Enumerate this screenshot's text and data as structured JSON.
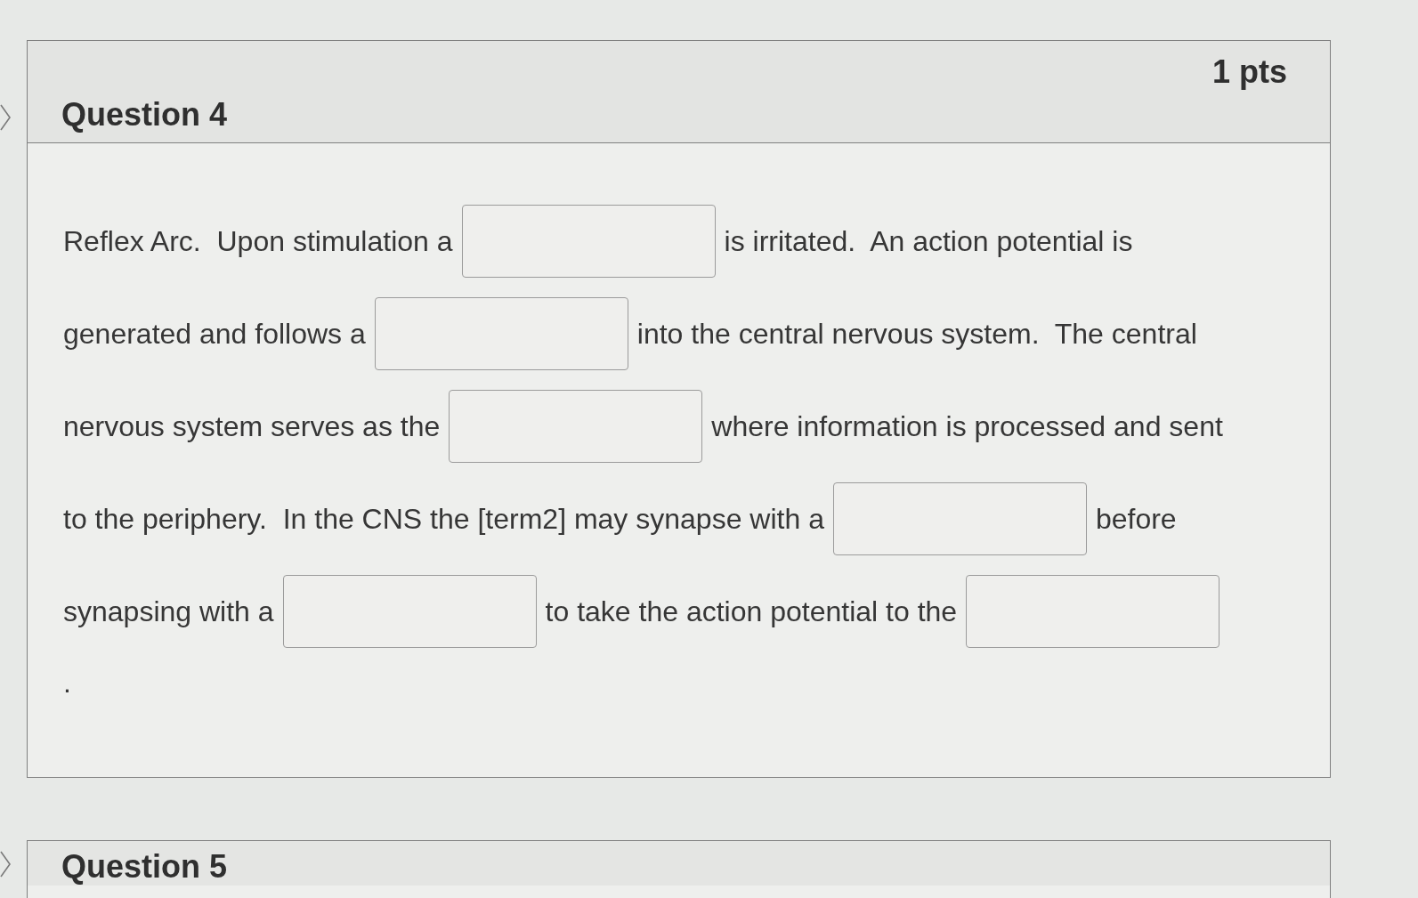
{
  "questions": [
    {
      "title": "Question 4",
      "points": "1 pts",
      "lines": [
        [
          {
            "kind": "text",
            "text": "Reflex Arc.  Upon stimulation a"
          },
          {
            "kind": "blank"
          },
          {
            "kind": "text",
            "text": "is irritated.  An action potential is"
          }
        ],
        [
          {
            "kind": "text",
            "text": "generated and follows a"
          },
          {
            "kind": "blank"
          },
          {
            "kind": "text",
            "text": "into the central nervous system.  The central"
          }
        ],
        [
          {
            "kind": "text",
            "text": "nervous system serves as the"
          },
          {
            "kind": "blank"
          },
          {
            "kind": "text",
            "text": "where information is processed and sent"
          }
        ],
        [
          {
            "kind": "text",
            "text": "to the periphery.  In the CNS the [term2] may synapse with a"
          },
          {
            "kind": "blank"
          },
          {
            "kind": "text",
            "text": "before"
          }
        ],
        [
          {
            "kind": "text",
            "text": "synapsing with a"
          },
          {
            "kind": "blank"
          },
          {
            "kind": "text",
            "text": "to take the action potential to the"
          },
          {
            "kind": "blank"
          }
        ],
        [
          {
            "kind": "text",
            "text": "."
          }
        ]
      ]
    },
    {
      "title": "Question 5"
    }
  ]
}
